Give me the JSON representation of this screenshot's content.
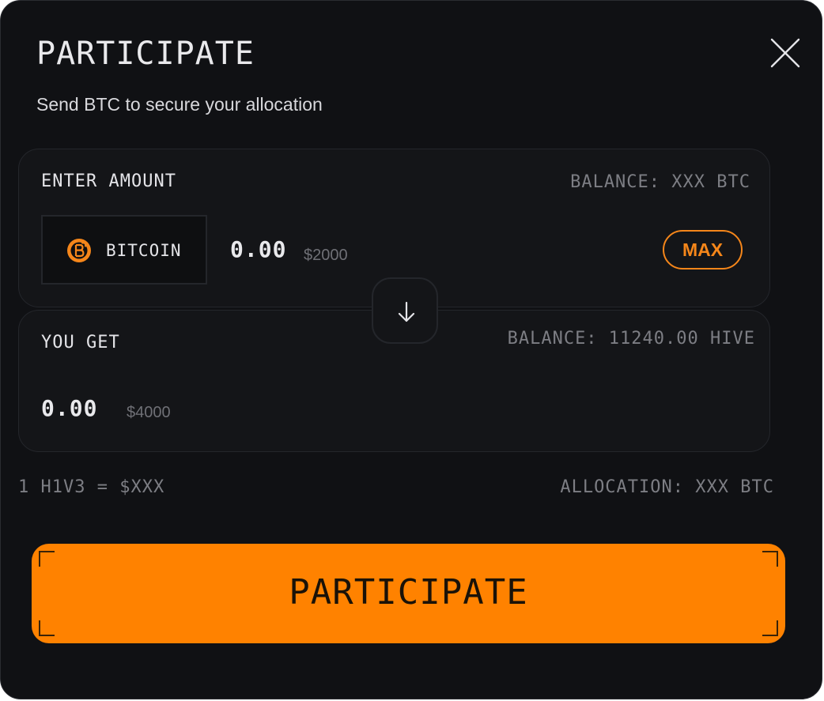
{
  "modal": {
    "title": "PARTICIPATE",
    "subtitle": "Send BTC to secure your allocation",
    "close_icon": "close-icon"
  },
  "send_panel": {
    "label": "ENTER AMOUNT",
    "balance": "BALANCE: XXX BTC",
    "token": {
      "name": "BITCOIN",
      "icon": "bitcoin-icon",
      "icon_color": "#f5861a"
    },
    "amount": "0.00",
    "usd_value": "$2000",
    "max_label": "MAX"
  },
  "swap": {
    "icon": "arrow-down-icon"
  },
  "receive_panel": {
    "label": "YOU GET",
    "balance": "BALANCE: 11240.00 HIVE",
    "amount": "0.00",
    "usd_value": "$4000"
  },
  "info": {
    "rate": "1 H1V3 = $XXX",
    "allocation": "ALLOCATION: XXX BTC"
  },
  "cta": {
    "label": "PARTICIPATE"
  },
  "colors": {
    "background": "#101114",
    "panel": "#141518",
    "accent": "#ff8200",
    "max_accent": "#f5861a",
    "text": "#e9e9ec",
    "muted": "#7d7e84"
  }
}
